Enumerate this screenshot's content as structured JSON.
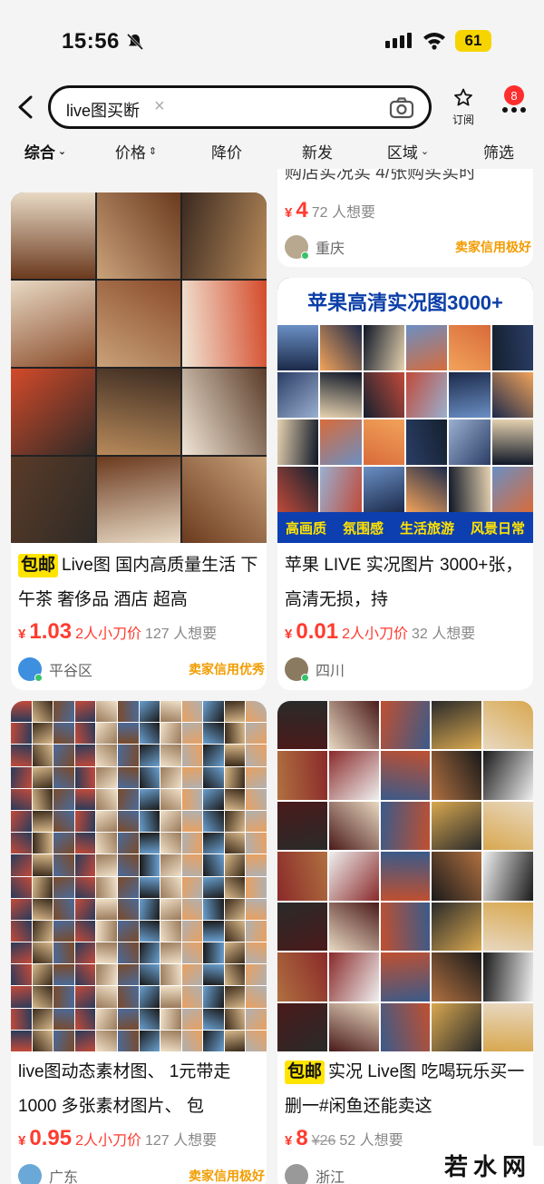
{
  "status_bar": {
    "time": "15:56",
    "battery": "61"
  },
  "search": {
    "query": "live图买断",
    "follow_label": "订阅",
    "notification_count": "8"
  },
  "filters": [
    {
      "label": "综合",
      "suffix": "⌄",
      "active": true
    },
    {
      "label": "价格",
      "suffix": "⇕",
      "active": false
    },
    {
      "label": "降价",
      "suffix": "",
      "active": false
    },
    {
      "label": "新发",
      "suffix": "",
      "active": false
    },
    {
      "label": "区域",
      "suffix": "⌄",
      "active": false
    },
    {
      "label": "筛选",
      "suffix": "",
      "active": false
    }
  ],
  "partial_card": {
    "title_fragment": "购店实况实 4/张购买实时",
    "currency": "¥",
    "price": "4",
    "wants": "72 人想要",
    "location": "重庆",
    "credit": "卖家信用极好"
  },
  "cards": [
    {
      "tag": "包邮",
      "title": "Live图 国内高质量生活 下午茶 奢侈品 酒店 超高",
      "currency": "¥",
      "price": "1.03",
      "cut": "2人小刀价",
      "old_price": "",
      "wants": "127 人想要",
      "location": "平谷区",
      "credit": "卖家信用优秀"
    },
    {
      "tag": "",
      "title": "苹果 LIVE 实况图片 3000+张，高清无损，持",
      "currency": "¥",
      "price": "0.01",
      "cut": "2人小刀价",
      "old_price": "",
      "wants": "32 人想要",
      "location": "四川",
      "credit": "",
      "banner_title": "苹果高清实况图3000+",
      "banner_tags": [
        "高画质",
        "氛围感",
        "生活旅游",
        "风景日常"
      ]
    },
    {
      "tag": "",
      "title": "live图动态素材图、 1元带走1000 多张素材图片、 包",
      "currency": "¥",
      "price": "0.95",
      "cut": "2人小刀价",
      "old_price": "",
      "wants": "127 人想要",
      "location": "广东",
      "credit": "卖家信用极好"
    },
    {
      "tag": "包邮",
      "title": "实况 Live图 吃喝玩乐买一删一#闲鱼还能卖这",
      "currency": "¥",
      "price": "8",
      "cut": "",
      "old_price": "¥26",
      "wants": "52 人想要",
      "location": "浙江",
      "credit": ""
    }
  ],
  "watermark": "若水网",
  "colors": {
    "accent_red": "#ff3b2f",
    "tag_yellow": "#ffe400",
    "credit_orange": "#f29c00",
    "banner_blue": "#0d3fb0"
  }
}
